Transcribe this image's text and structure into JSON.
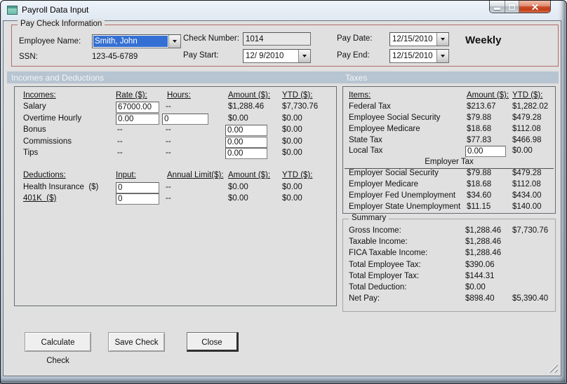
{
  "colors": {
    "selection_blue": "#3470d3",
    "groupbox_red_border": "#b46a6a",
    "section_band_blue_gray": "#b7c4d1",
    "close_button_red": "#cc4f2e",
    "client_gray": "#e0e0e0"
  },
  "window": {
    "title": "Payroll Data Input"
  },
  "paycheck": {
    "title": "Pay Check Information",
    "employee_name_label": "Employee Name:",
    "employee_name_value": "Smith, John",
    "ssn_label": "SSN:",
    "ssn_value": "123-45-6789",
    "check_number_label": "Check Number:",
    "check_number_value": "1014",
    "pay_start_label": "Pay Start:",
    "pay_start_value": "12/ 9/2010",
    "pay_date_label": "Pay Date:",
    "pay_date_value": "12/15/2010",
    "pay_end_label": "Pay End:",
    "pay_end_value": "12/15/2010",
    "frequency": "Weekly"
  },
  "bands": {
    "incomes": "Incomes and Deductions",
    "taxes": "Taxes"
  },
  "incomes": {
    "headers": {
      "label": "Incomes:",
      "rate": "Rate ($):",
      "hours": "Hours:",
      "amount": "Amount ($):",
      "ytd": "YTD ($):"
    },
    "rows": [
      {
        "label": "Salary",
        "rate": "67000.00",
        "hours": "--",
        "amount": "$1,288.46",
        "ytd": "$7,730.76"
      },
      {
        "label": "Overtime Hourly",
        "rate": "0.00",
        "hours": "0",
        "amount": "$0.00",
        "ytd": "$0.00"
      },
      {
        "label": "Bonus",
        "rate": "--",
        "hours": "--",
        "amount": "0.00",
        "ytd": "$0.00"
      },
      {
        "label": "Commissions",
        "rate": "--",
        "hours": "--",
        "amount": "0.00",
        "ytd": "$0.00"
      },
      {
        "label": "Tips",
        "rate": "--",
        "hours": "--",
        "amount": "0.00",
        "ytd": "$0.00"
      }
    ],
    "deduction_headers": {
      "label": "Deductions:",
      "input": "Input:",
      "limit": "Annual Limit($):",
      "amount": "Amount ($):",
      "ytd": "YTD ($):"
    },
    "deduction_rows": [
      {
        "label": "Health Insurance  ($)",
        "input": "0",
        "limit": "--",
        "amount": "$0.00",
        "ytd": "$0.00"
      },
      {
        "label": "401K  ($)",
        "input": "0",
        "limit": "--",
        "amount": "$0.00",
        "ytd": "$0.00"
      }
    ]
  },
  "taxes": {
    "headers": {
      "label": "Items:",
      "amount": "Amount ($):",
      "ytd": "YTD ($):"
    },
    "employee_rows": [
      {
        "label": "Federal Tax",
        "amount": "$213.67",
        "ytd": "$1,282.02"
      },
      {
        "label": "Employee Social Security",
        "amount": "$79.88",
        "ytd": "$479.28"
      },
      {
        "label": "Employee Medicare",
        "amount": "$18.68",
        "ytd": "$112.08"
      },
      {
        "label": "State Tax",
        "amount": "$77.83",
        "ytd": "$466.98"
      }
    ],
    "local_tax": {
      "label": "Local Tax",
      "amount_input": "0.00",
      "ytd": "$0.00"
    },
    "employer_header": "Employer Tax",
    "employer_rows": [
      {
        "label": "Employer Social Security",
        "amount": "$79.88",
        "ytd": "$479.28"
      },
      {
        "label": "Employer Medicare",
        "amount": "$18.68",
        "ytd": "$112.08"
      },
      {
        "label": "Employer Fed Unemployment",
        "amount": "$34.60",
        "ytd": "$434.00"
      },
      {
        "label": "Employer State Unemployment",
        "amount": "$11.15",
        "ytd": "$140.00"
      }
    ]
  },
  "summary": {
    "title": "Summary",
    "rows": [
      {
        "label": "Gross Income:",
        "amount": "$1,288.46",
        "ytd": "$7,730.76"
      },
      {
        "label": "Taxable Income:",
        "amount": "$1,288.46",
        "ytd": ""
      },
      {
        "label": "FICA Taxable Income:",
        "amount": "$1,288.46",
        "ytd": ""
      },
      {
        "label": "Total Employee Tax:",
        "amount": "$390.06",
        "ytd": ""
      },
      {
        "label": "Total Employer Tax:",
        "amount": "$144.31",
        "ytd": ""
      },
      {
        "label": "Total Deduction:",
        "amount": "$0.00",
        "ytd": ""
      },
      {
        "label": "Net Pay:",
        "amount": "$898.40",
        "ytd": "$5,390.40"
      }
    ]
  },
  "buttons": {
    "calculate": "Calculate Check",
    "save": "Save Check",
    "close": "Close"
  }
}
